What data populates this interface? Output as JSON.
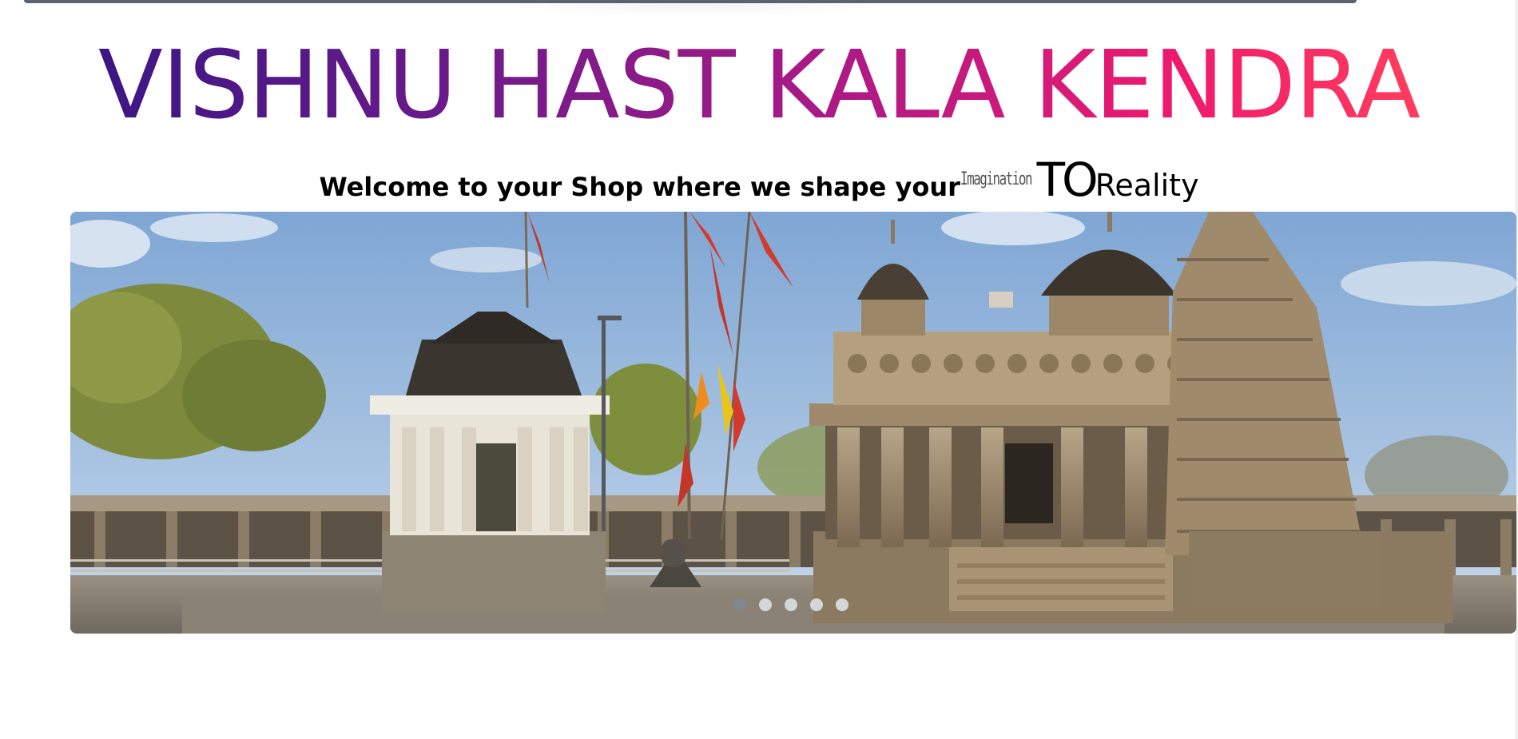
{
  "header": {
    "brand_title": "VISHNU HAST KALA KENDRA"
  },
  "tagline": {
    "welcome": "Welcome to your Shop where we shape your",
    "imagination": "Imagination",
    "to": "TO",
    "reality": "Reality"
  },
  "carousel": {
    "slide_count": 5,
    "active_index": 0
  },
  "colors": {
    "title_gradient_start": "#3d1585",
    "title_gradient_end": "#ff3d5d",
    "page_background": "#ffffff"
  }
}
